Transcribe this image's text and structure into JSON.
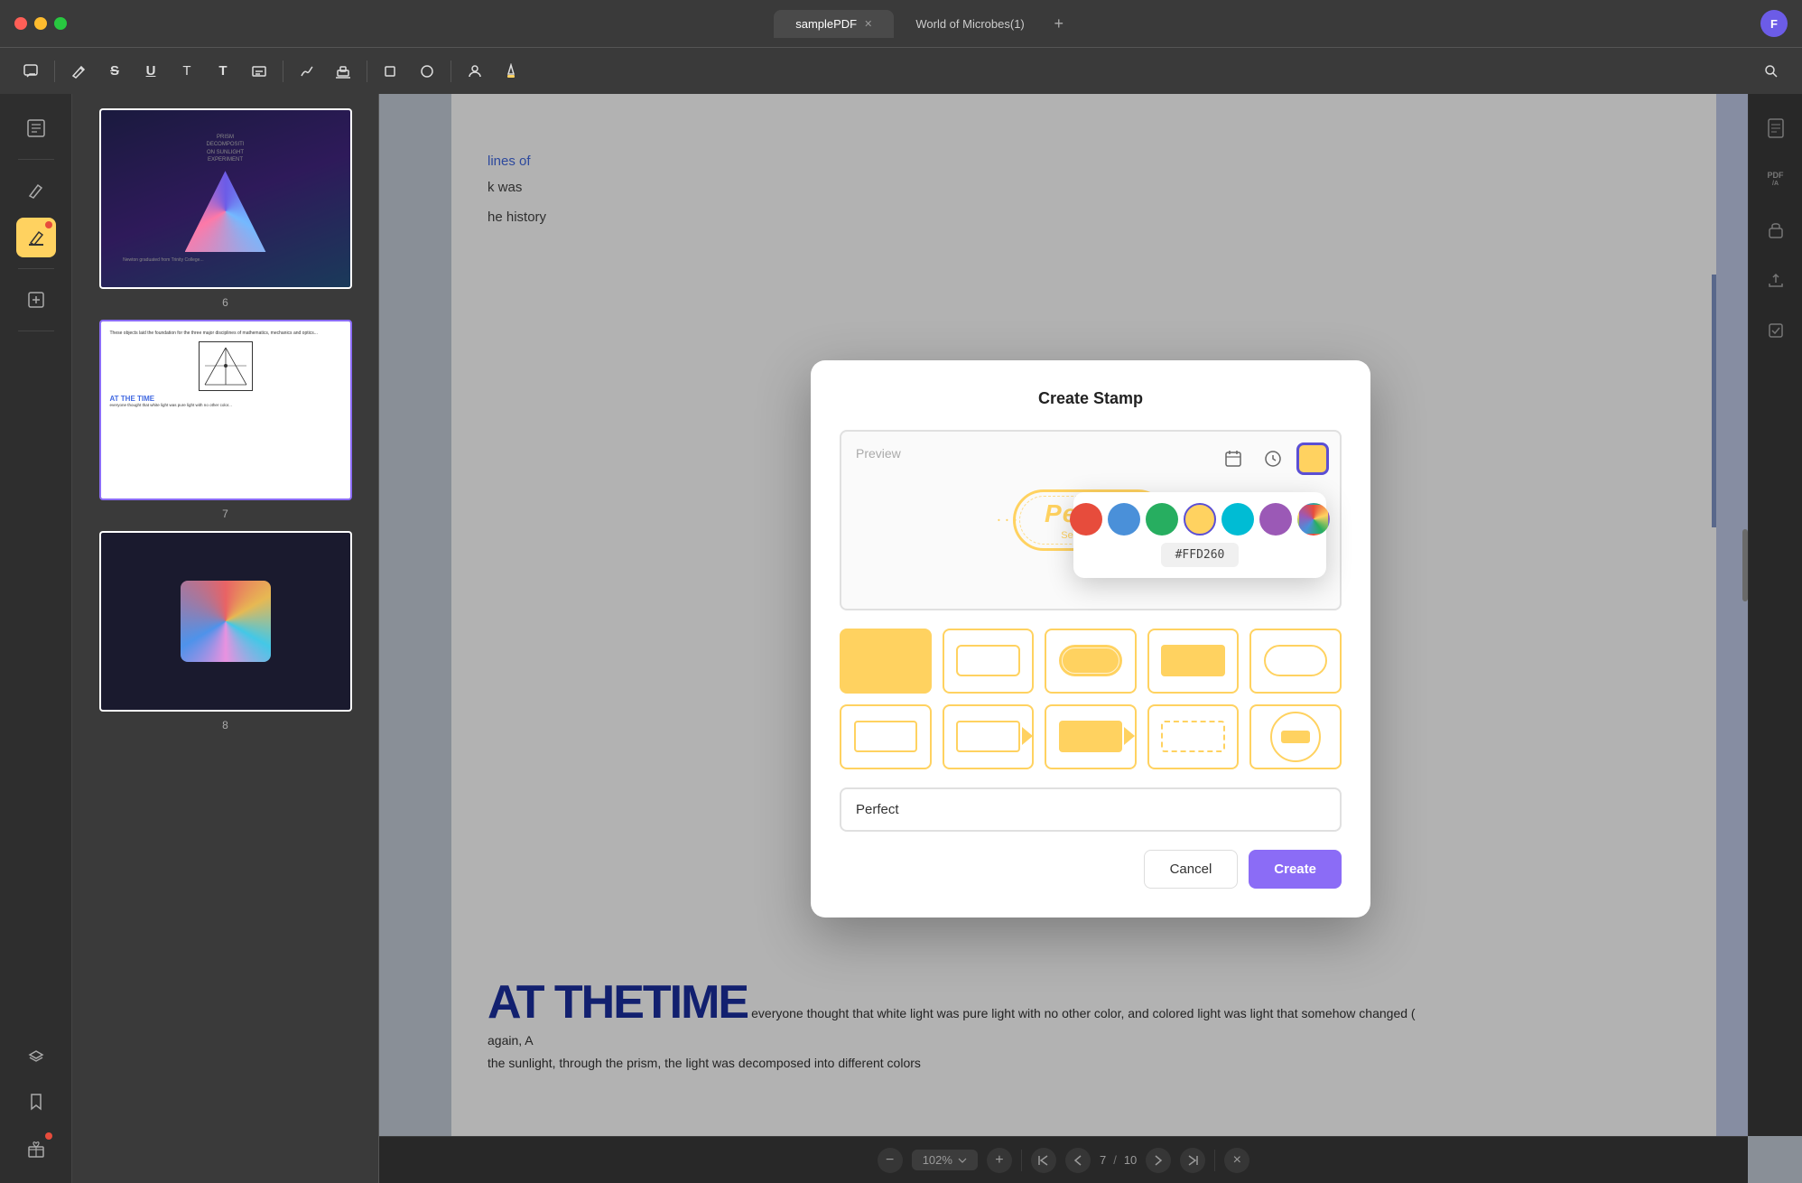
{
  "titlebar": {
    "tab1_label": "samplePDF",
    "tab2_label": "World of Microbes(1)",
    "add_tab_label": "+",
    "user_initial": "F"
  },
  "toolbar": {
    "tools": [
      "☰",
      "✏",
      "S",
      "U",
      "T",
      "T",
      "⊞",
      "📋",
      "⬟",
      "⬜",
      "◯",
      "👤",
      "✒",
      "🔍"
    ],
    "dividers": [
      1,
      7,
      9,
      11,
      13
    ]
  },
  "sidebar": {
    "items": [
      {
        "name": "pages-icon",
        "icon": "⊞",
        "active": false
      },
      {
        "name": "separator1",
        "divider": true
      },
      {
        "name": "annotate-icon",
        "icon": "✏",
        "active": false
      },
      {
        "name": "highlight-icon",
        "icon": "🖊",
        "active": true,
        "highlight": true
      },
      {
        "name": "separator2",
        "divider": true
      },
      {
        "name": "edit-icon",
        "icon": "✎",
        "active": false
      },
      {
        "name": "separator3",
        "divider": true
      },
      {
        "name": "layers-icon",
        "icon": "◫",
        "active": false
      },
      {
        "name": "bookmark-icon",
        "icon": "🔖",
        "active": false
      },
      {
        "name": "gift-icon",
        "icon": "🎁",
        "badge": true
      }
    ]
  },
  "thumbnails": [
    {
      "page": "6",
      "selected": false
    },
    {
      "page": "7",
      "selected": true
    },
    {
      "page": "8",
      "selected": false
    }
  ],
  "modal": {
    "title": "Create Stamp",
    "preview_label": "Preview",
    "stamp_text": "Perfect",
    "stamp_date": "Sep 30, 2022",
    "text_input_value": "Perfect",
    "cancel_label": "Cancel",
    "create_label": "Create"
  },
  "color_picker": {
    "colors": [
      {
        "name": "red",
        "hex": "#e74c3c"
      },
      {
        "name": "blue",
        "hex": "#4a90d9"
      },
      {
        "name": "green",
        "hex": "#27ae60"
      },
      {
        "name": "yellow",
        "hex": "#ffd260",
        "selected": true
      },
      {
        "name": "cyan",
        "hex": "#00bcd4"
      },
      {
        "name": "purple",
        "hex": "#9b59b6"
      },
      {
        "name": "multicolor",
        "hex": "multicolor"
      }
    ],
    "current_hex": "#FFD260"
  },
  "page_content": {
    "blue_lines": "lines of",
    "line2": "k was",
    "line3": "he history",
    "big_heading": "AT THETIME",
    "body_text1": "everyone thought that white light was pure light with no other color, and colored light was light that somehow changed (",
    "body_text2": "again, A",
    "body_text3": "the sunlight, through the prism, the light was decomposed into different colors"
  },
  "bottom_bar": {
    "zoom_out": "−",
    "zoom_level": "102%",
    "zoom_in": "+",
    "nav_top": "⊤",
    "nav_up": "∧",
    "current_page": "7",
    "separator": "/",
    "total_pages": "10",
    "nav_down": "∨",
    "nav_bottom": "⊥",
    "close": "×"
  },
  "right_toolbar": {
    "icons": [
      "📄",
      "PDF/A",
      "🔒",
      "⬆",
      "✓"
    ]
  }
}
